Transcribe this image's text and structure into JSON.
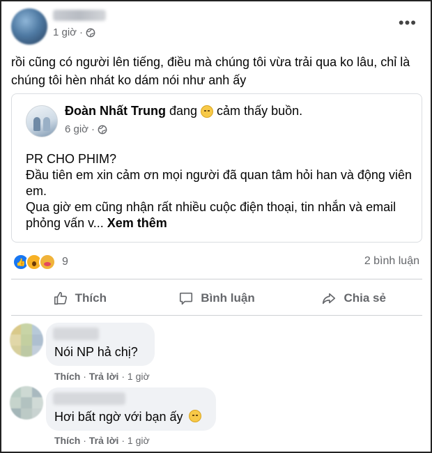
{
  "post": {
    "time": "1 giờ",
    "text": "rồi cũng có người lên tiếng, điều mà chúng tôi vừa trải qua ko lâu, chỉ là chúng tôi hèn nhát ko dám nói như anh ấy",
    "more_icon": "ellipsis-icon",
    "privacy_icon": "globe-icon"
  },
  "shared": {
    "name": "Đoàn Nhất Trung",
    "feeling_prefix": "đang",
    "feeling_text": "cảm thấy buồn.",
    "time": "6 giờ",
    "lines": [
      "PR CHO PHIM?",
      "Đầu tiên em xin cảm ơn mọi người đã quan tâm hỏi han và động viên em.",
      "Qua giờ em cũng nhận rất nhiều cuộc điện thoại, tin nhắn và email phỏng vấn v..."
    ],
    "see_more": "Xem thêm"
  },
  "reactions": {
    "count": "9",
    "comments": "2 bình luận"
  },
  "actions": {
    "like": "Thích",
    "comment": "Bình luận",
    "share": "Chia sẻ"
  },
  "comments": [
    {
      "text": "Nói NP hả chị?",
      "like": "Thích",
      "reply": "Trả lời",
      "time": "1 giờ"
    },
    {
      "text": "Hơi bất ngờ với bạn ấy",
      "like": "Thích",
      "reply": "Trả lời",
      "time": "1 giờ"
    }
  ],
  "colors": {
    "like_blue": "#1877f2",
    "secondary_text": "#65676b",
    "bubble_bg": "#f0f2f5"
  }
}
